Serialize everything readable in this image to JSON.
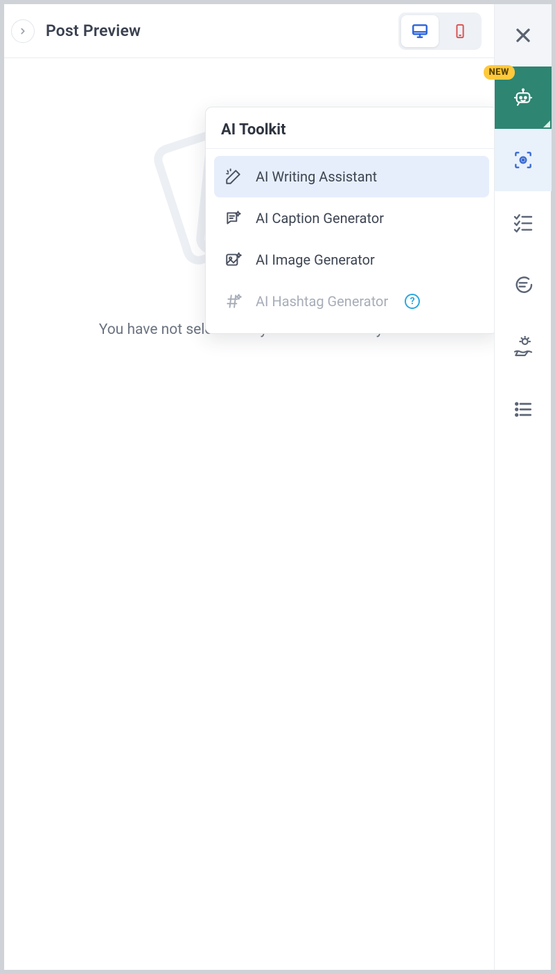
{
  "header": {
    "title": "Post Preview",
    "device_active": "desktop"
  },
  "placeholder": {
    "message": "You have not selected any social accounts yet."
  },
  "toolkit": {
    "title": "AI Toolkit",
    "items": [
      {
        "label": "AI Writing Assistant",
        "selected": true,
        "disabled": false,
        "help": false
      },
      {
        "label": "AI Caption Generator",
        "selected": false,
        "disabled": false,
        "help": false
      },
      {
        "label": "AI Image Generator",
        "selected": false,
        "disabled": false,
        "help": false
      },
      {
        "label": "AI Hashtag Generator",
        "selected": false,
        "disabled": true,
        "help": true
      }
    ]
  },
  "sidebar": {
    "new_badge": "NEW",
    "items": [
      {
        "name": "close"
      },
      {
        "name": "ai-bot"
      },
      {
        "name": "preview"
      },
      {
        "name": "checklist"
      },
      {
        "name": "comments"
      },
      {
        "name": "ideas"
      },
      {
        "name": "list"
      }
    ]
  },
  "colors": {
    "accent_blue": "#2b63d9",
    "accent_teal": "#2e8571",
    "badge_yellow": "#ffc93c",
    "danger": "#d95454"
  }
}
